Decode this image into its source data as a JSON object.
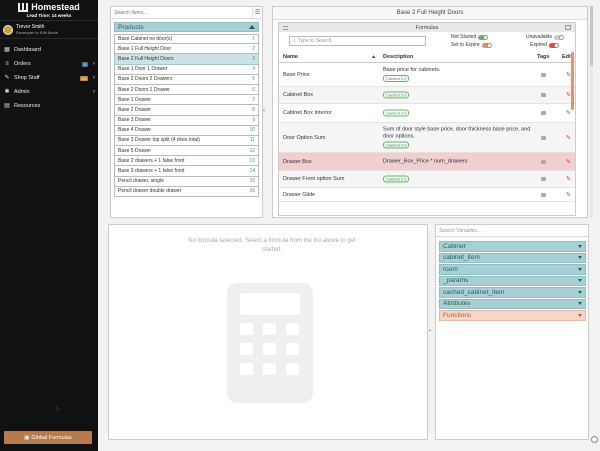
{
  "sidebar": {
    "brand": "Homestead",
    "lead_time": "Lead Time: 14 weeks",
    "user": {
      "name": "Trevor Smith",
      "subtitle": "Developer to Edit Mode"
    },
    "nav": [
      {
        "label": "Dashboard",
        "icon": "dashboard-icon"
      },
      {
        "label": "Orders",
        "icon": "orders-icon",
        "badge": "0"
      },
      {
        "label": "Shop Staff",
        "icon": "staff-icon",
        "badge": "12"
      },
      {
        "label": "Admin",
        "icon": "admin-icon"
      },
      {
        "label": "Resources",
        "icon": "resources-icon"
      }
    ],
    "global_button": "Global Formulas"
  },
  "products": {
    "search_placeholder": "Search Items...",
    "group": "Products",
    "items": [
      {
        "label": "Base Cabinet no door(s)",
        "num": "1"
      },
      {
        "label": "Base 1 Full Height Door",
        "num": "2"
      },
      {
        "label": "Base 2 Full Height Doors",
        "num": "3"
      },
      {
        "label": "Base 1 Door 1 Drawer",
        "num": "4"
      },
      {
        "label": "Base 2 Doors 2 Drawers",
        "num": "5"
      },
      {
        "label": "Base 2 Doors 1 Drawer",
        "num": "6"
      },
      {
        "label": "Base 1 Drawer",
        "num": "7"
      },
      {
        "label": "Base 2 Drawer",
        "num": "8"
      },
      {
        "label": "Base 3 Drawer",
        "num": "9"
      },
      {
        "label": "Base 4 Drawer",
        "num": "10"
      },
      {
        "label": "Base 3 Drawer top split (4 drws total)",
        "num": "11"
      },
      {
        "label": "Base 5 Drawer",
        "num": "12"
      },
      {
        "label": "Base 2 drawers + 1 false front",
        "num": "13"
      },
      {
        "label": "Base 3 drawers + 1 false front",
        "num": "14"
      },
      {
        "label": "Pencil drawer, single",
        "num": "15"
      },
      {
        "label": "Pencil drawer double drawer",
        "num": "16"
      }
    ]
  },
  "formulas": {
    "panel_title": "Base 2 Full Height Doors",
    "box_title": "Formulas",
    "search_placeholder": "Type to Search",
    "status": {
      "not_started": "Not Started",
      "set_to_expire": "Set to Expire",
      "unavailable": "Unavailable",
      "expired": "Expired"
    },
    "columns": {
      "name": "Name",
      "description": "Description",
      "tags": "Tags",
      "edit": "Edit"
    },
    "rows": [
      {
        "name": "Base Price",
        "desc": "Base price for cabinets.",
        "badge": "Cached 2.0"
      },
      {
        "name": "Cabinet Box",
        "desc": "",
        "badge": "Cached 2.0"
      },
      {
        "name": "Cabinet Box Interior",
        "desc": "",
        "badge": "Cached 2.0"
      },
      {
        "name": "Door Option Sum",
        "desc": "Sum of door style base price, door thickness base price, and door options.",
        "badge": "Cached 2.0"
      },
      {
        "name": "Drawer Box",
        "desc": "Drawer_Box_Price * num_drawers",
        "badge": ""
      },
      {
        "name": "Drawer Front option Sum",
        "desc": "",
        "badge": "Cached 2.0"
      },
      {
        "name": "Drawer Glide",
        "desc": "",
        "badge": ""
      }
    ]
  },
  "empty_state": {
    "message": "No formula selected. Select a formula from the list above to get started."
  },
  "variables": {
    "search_placeholder": "Search Variables...",
    "items": [
      {
        "label": "Cabinet"
      },
      {
        "label": "cabinet_item"
      },
      {
        "label": "room"
      },
      {
        "label": "_params"
      },
      {
        "label": "cached_cabinet_item"
      },
      {
        "label": "Attributes"
      },
      {
        "label": "Functions"
      }
    ]
  },
  "colors": {
    "sidebar_bg": "#111111",
    "accent_teal": "#a6d0d6",
    "accent_orange": "#f3d6c6",
    "global_button": "#b57b4d",
    "selected_row": "#efcfcf"
  }
}
